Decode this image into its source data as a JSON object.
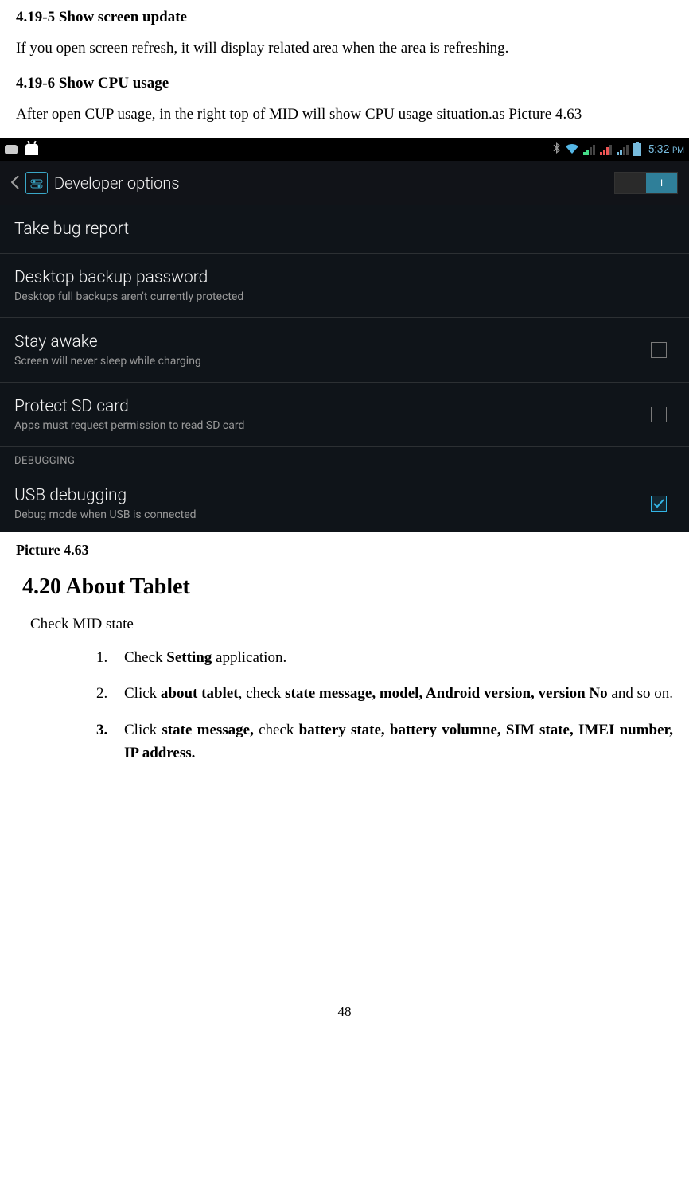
{
  "section5_heading": "4.19-5 Show screen update",
  "section5_body": "If you open screen refresh, it will display related area when the area is refreshing.",
  "section6_heading": "4.19-6 Show CPU usage",
  "section6_body": "After open CUP usage, in the right top of MID will show CPU usage situation.as Picture 4.63",
  "screenshot": {
    "statusbar": {
      "time": "5:32",
      "period": "PM"
    },
    "header": {
      "title": "Developer options",
      "toggle_on": "I"
    },
    "rows": {
      "bug": {
        "title": "Take bug report"
      },
      "backup": {
        "title": "Desktop backup password",
        "sub": "Desktop full backups aren't currently protected"
      },
      "stay": {
        "title": "Stay awake",
        "sub": "Screen will never sleep while charging"
      },
      "sd": {
        "title": "Protect SD card",
        "sub": "Apps must request permission to read SD card"
      },
      "usb": {
        "title": "USB debugging",
        "sub": "Debug mode when USB is connected"
      }
    },
    "section_label": "DEBUGGING"
  },
  "caption": "Picture 4.63",
  "h2": "4.20 About Tablet",
  "about_intro": "Check MID state",
  "li1_a": "Check ",
  "li1_b": "Setting",
  "li1_c": " application.",
  "li2_a": "Click ",
  "li2_b": "about tablet",
  "li2_c": ", check ",
  "li2_d": "state message, model, Android version, version No",
  "li2_e": " and so on.",
  "li3_a": "Click ",
  "li3_b": "state message,",
  "li3_c": " check ",
  "li3_d": "battery state, battery volumne, SIM state, IMEI number, IP address.",
  "page_number": "48"
}
